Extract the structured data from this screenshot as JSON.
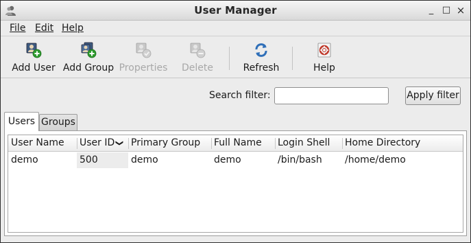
{
  "window": {
    "title": "User Manager",
    "icon": "user-manager-app-icon",
    "controls": {
      "minimize": "_",
      "maximize": "□",
      "close": "×"
    }
  },
  "menu": {
    "file": "File",
    "edit": "Edit",
    "help": "Help"
  },
  "toolbar": {
    "add_user": "Add User",
    "add_group": "Add Group",
    "properties": "Properties",
    "delete": "Delete",
    "refresh": "Refresh",
    "help": "Help"
  },
  "search": {
    "label": "Search filter:",
    "value": "",
    "apply_label": "Apply filter"
  },
  "tabs": {
    "users": "Users",
    "groups": "Groups",
    "active": "Users"
  },
  "table": {
    "columns": [
      "User Name",
      "User ID",
      "Primary Group",
      "Full Name",
      "Login Shell",
      "Home Directory"
    ],
    "sort_column": "User ID",
    "sort_indicator": "chevron-down-icon",
    "rows": [
      [
        "demo",
        "500",
        "demo",
        "demo",
        "/bin/bash",
        "/home/demo"
      ]
    ]
  },
  "colors": {
    "window_bg": "#ececec",
    "disabled_text": "#a8a8a8",
    "accent_green": "#2e9b2e",
    "refresh_blue": "#2f6fb8",
    "help_red": "#c0392b"
  }
}
